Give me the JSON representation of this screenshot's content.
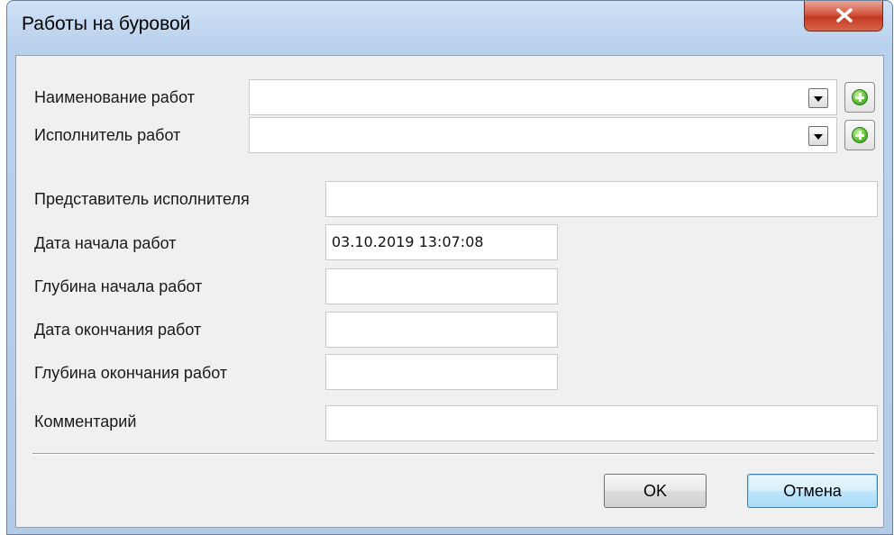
{
  "window": {
    "title": "Работы на буровой",
    "close_icon": "close-x-icon"
  },
  "form": {
    "work_name": {
      "label": "Наименование работ",
      "value": ""
    },
    "executor": {
      "label": "Исполнитель работ",
      "value": ""
    },
    "executor_rep": {
      "label": "Представитель исполнителя",
      "value": ""
    },
    "start_date": {
      "label": "Дата начала работ",
      "value": "03.10.2019 13:07:08"
    },
    "start_depth": {
      "label": "Глубина начала работ",
      "value": ""
    },
    "end_date": {
      "label": "Дата окончания работ",
      "value": ""
    },
    "end_depth": {
      "label": "Глубина окончания работ",
      "value": ""
    },
    "comment": {
      "label": "Комментарий",
      "value": ""
    }
  },
  "buttons": {
    "ok": "OK",
    "cancel": "Отмена"
  },
  "icons": {
    "dropdown": "chevron-down-icon",
    "add": "add-circle-icon"
  },
  "colors": {
    "title_bar": "#b9d1ec",
    "close_button": "#c9432b",
    "add_icon": "#5fc13a",
    "default_button_border": "#3c7fb1"
  }
}
